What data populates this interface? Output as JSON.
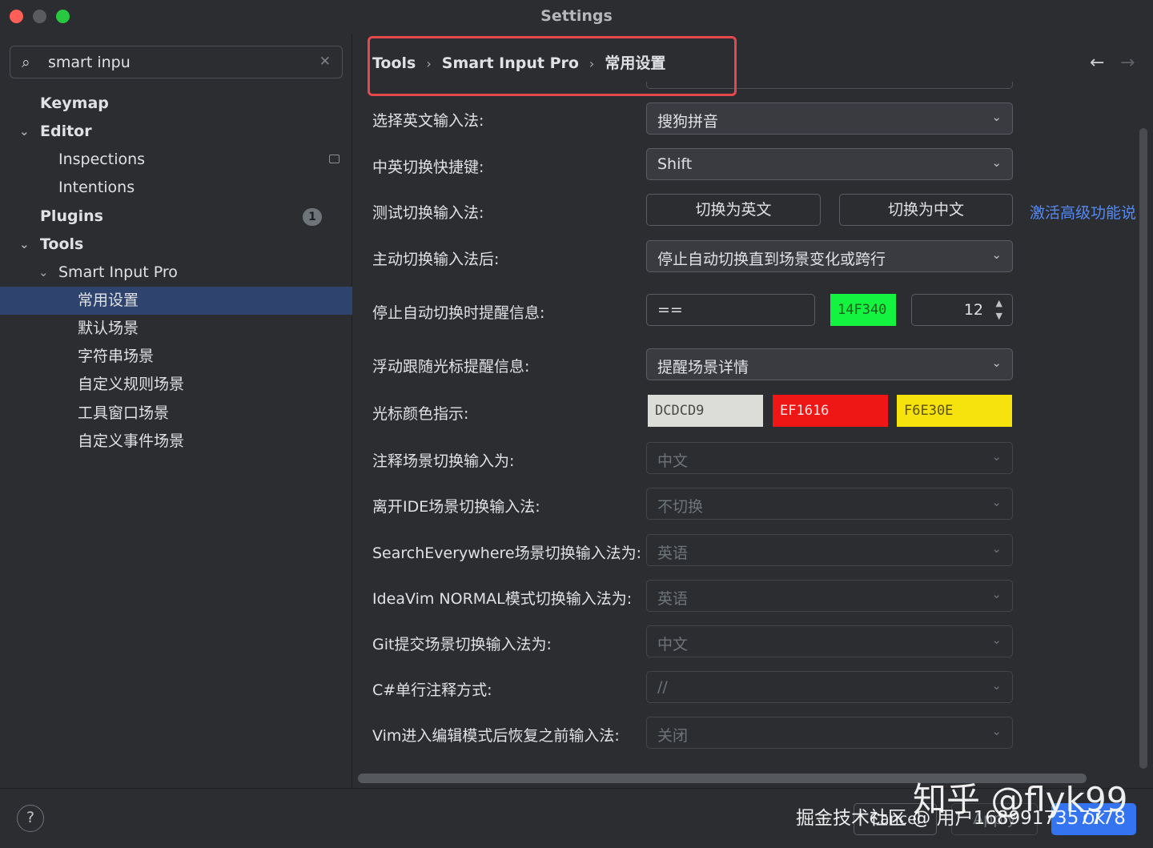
{
  "window": {
    "title": "Settings"
  },
  "search": {
    "value": "smart inpu"
  },
  "tree": {
    "keymap": "Keymap",
    "editor": "Editor",
    "inspections": "Inspections",
    "intentions": "Intentions",
    "plugins": "Plugins",
    "plugins_badge": "1",
    "tools": "Tools",
    "smart_input_pro": "Smart Input Pro",
    "general": "常用设置",
    "default_scene": "默认场景",
    "string_scene": "字符串场景",
    "custom_rule_scene": "自定义规则场景",
    "tool_window_scene": "工具窗口场景",
    "custom_event_scene": "自定义事件场景"
  },
  "breadcrumb": [
    "Tools",
    "Smart Input Pro",
    "常用设置"
  ],
  "form": {
    "english_ime": {
      "label": "选择英文输入法:",
      "value": "搜狗拼音"
    },
    "switch_hotkey": {
      "label": "中英切换快捷键:",
      "value": "Shift"
    },
    "test_switch": {
      "label": "测试切换输入法:",
      "btn_en": "切换为英文",
      "btn_zh": "切换为中文",
      "link": "激活高级功能说"
    },
    "after_manual": {
      "label": "主动切换输入法后:",
      "value": "停止自动切换直到场景变化或跨行"
    },
    "stop_tip": {
      "label": "停止自动切换时提醒信息:",
      "text": "==",
      "color": "14F340",
      "size": "12"
    },
    "float_tip": {
      "label": "浮动跟随光标提醒信息:",
      "value": "提醒场景详情"
    },
    "cursor_color": {
      "label": "光标颜色指示:",
      "c1": "DCDCD9",
      "c2": "EF1616",
      "c3": "F6E30E"
    },
    "comment_scene": {
      "label": "注释场景切换输入为:",
      "value": "中文"
    },
    "leave_ide": {
      "label": "离开IDE场景切换输入法:",
      "value": "不切换"
    },
    "search_everywhere": {
      "label": "SearchEverywhere场景切换输入法为:",
      "value": "英语"
    },
    "ideavim": {
      "label": "IdeaVim NORMAL模式切换输入法为:",
      "value": "英语"
    },
    "git_commit": {
      "label": "Git提交场景切换输入法为:",
      "value": "中文"
    },
    "csharp_comment": {
      "label": "C#单行注释方式:",
      "value": "//"
    },
    "vim_restore": {
      "label": "Vim进入编辑模式后恢复之前输入法:",
      "value": "关闭"
    }
  },
  "footer": {
    "cancel": "Cancel",
    "apply": "Apply",
    "ok": "OK",
    "help": "?"
  },
  "watermark": {
    "line1": "知乎 @flyk99",
    "line2": "掘金技术社区 @ 用户1689917357778"
  },
  "colors": {
    "accent": "#3574f0",
    "link": "#548af7",
    "selection": "#2e436e",
    "highlight_box": "#e5484d",
    "c1": "#DCDCD9",
    "c2": "#EF1616",
    "c3": "#F6E30E",
    "green": "#14F340"
  }
}
